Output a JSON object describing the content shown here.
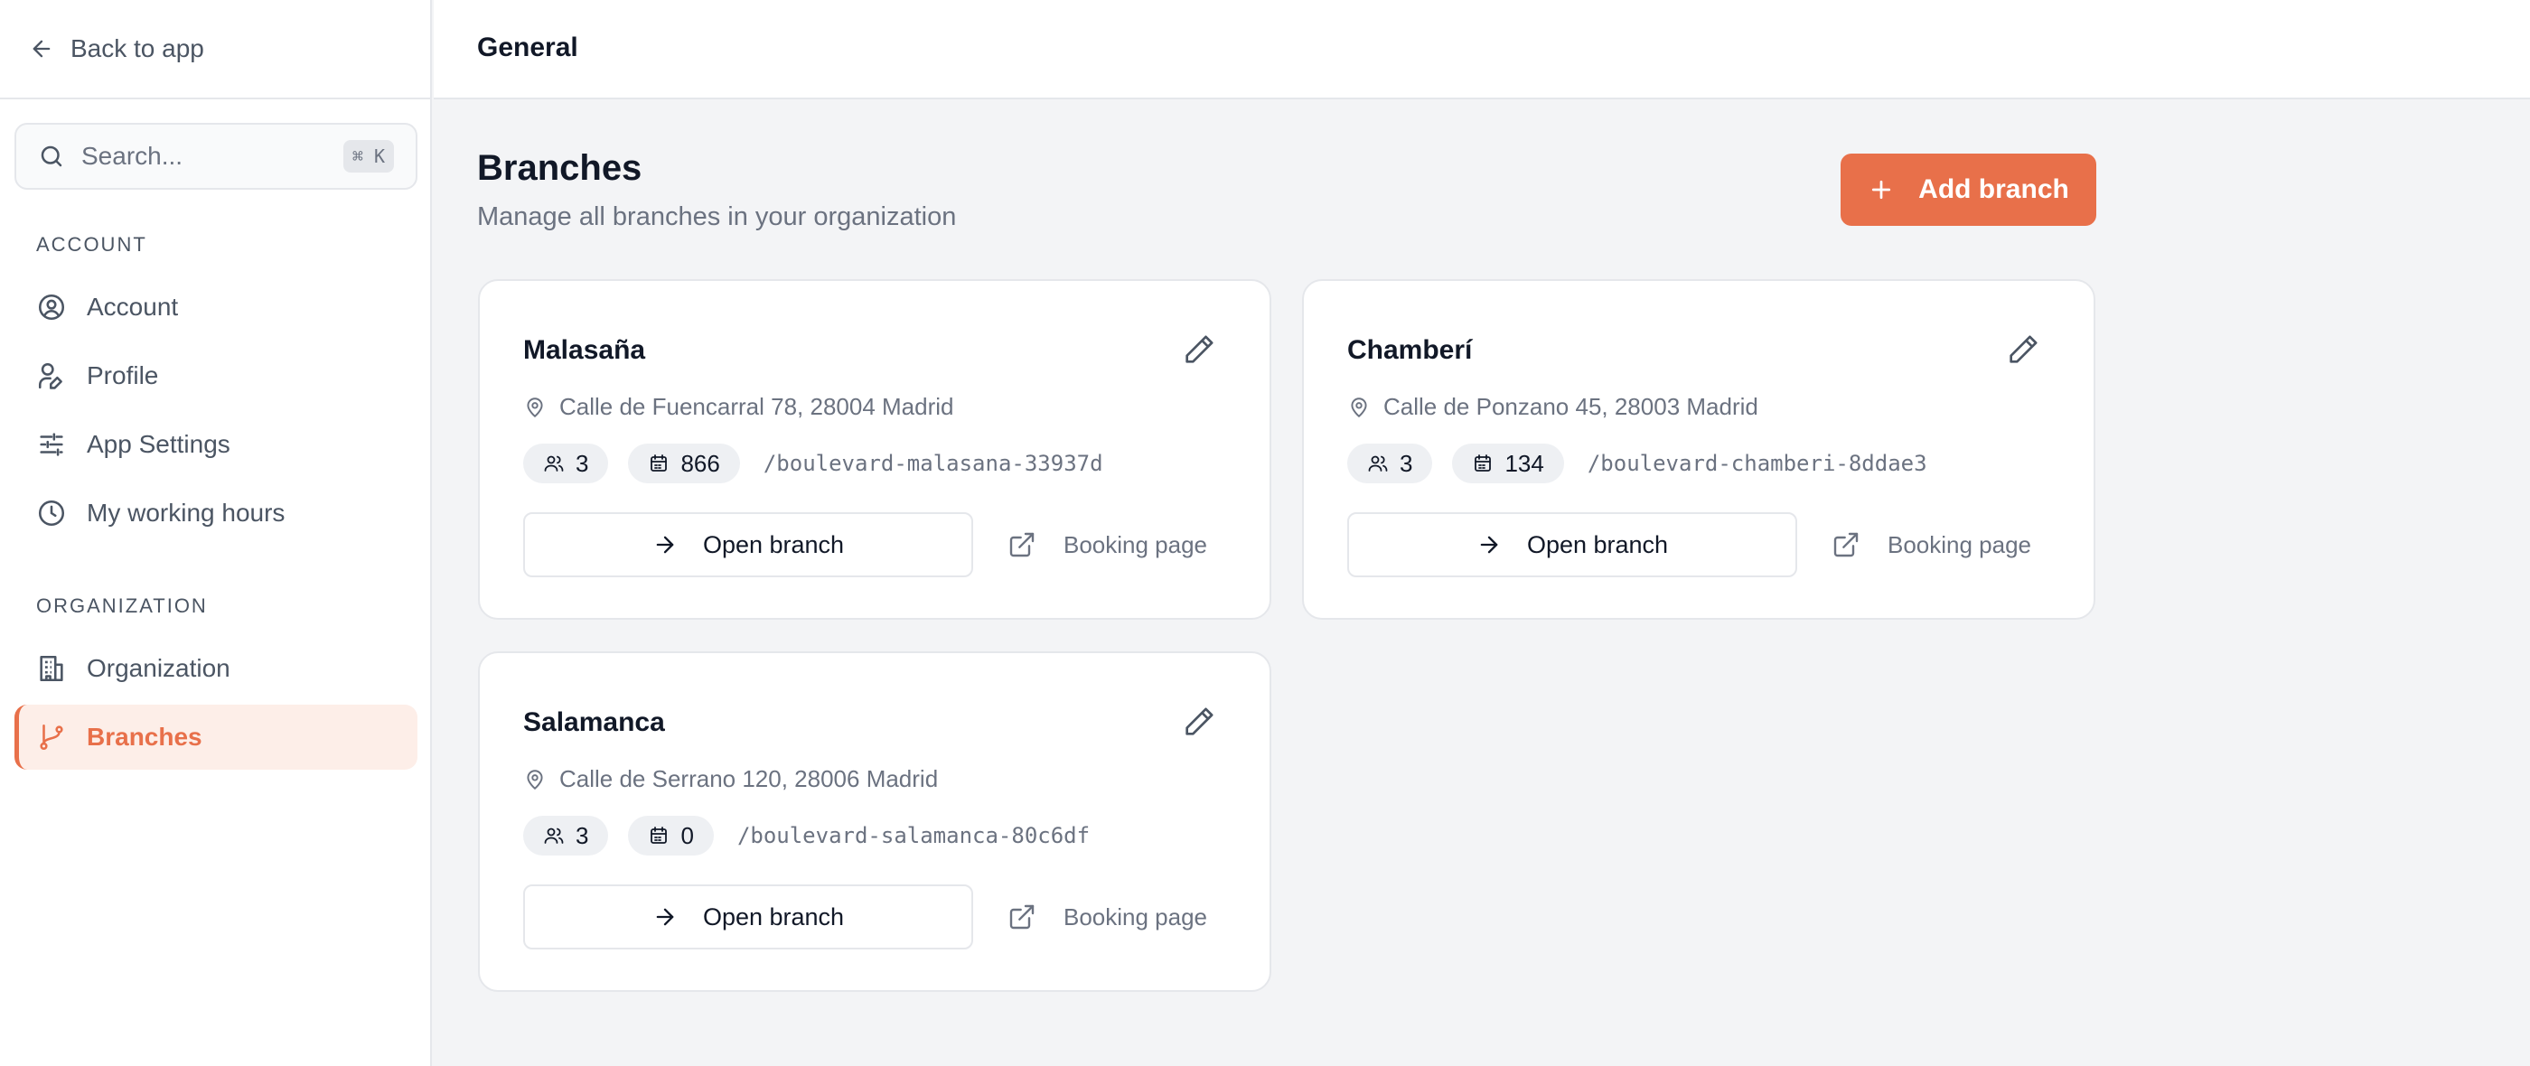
{
  "sidebar": {
    "back_label": "Back to app",
    "search": {
      "placeholder": "Search...",
      "shortcut": "⌘ K"
    },
    "account_section": "ACCOUNT",
    "account_items": [
      {
        "label": "Account",
        "icon": "user-circle-icon"
      },
      {
        "label": "Profile",
        "icon": "user-edit-icon"
      },
      {
        "label": "App Settings",
        "icon": "sliders-icon"
      },
      {
        "label": "My working hours",
        "icon": "clock-icon"
      }
    ],
    "organization_section": "ORGANIZATION",
    "organization_items": [
      {
        "label": "Organization",
        "icon": "building-icon"
      },
      {
        "label": "Branches",
        "icon": "git-branch-icon",
        "active": true
      }
    ]
  },
  "header": {
    "title": "General"
  },
  "page": {
    "title": "Branches",
    "subtitle": "Manage all branches in your organization",
    "add_button": "Add branch"
  },
  "branches": [
    {
      "name": "Malasaña",
      "address": "Calle de Fuencarral 78, 28004 Madrid",
      "members": "3",
      "bookings": "866",
      "slug": "/boulevard-malasana-33937d",
      "open_label": "Open branch",
      "booking_label": "Booking page"
    },
    {
      "name": "Chamberí",
      "address": "Calle de Ponzano 45, 28003 Madrid",
      "members": "3",
      "bookings": "134",
      "slug": "/boulevard-chamberi-8ddae3",
      "open_label": "Open branch",
      "booking_label": "Booking page"
    },
    {
      "name": "Salamanca",
      "address": "Calle de Serrano 120, 28006 Madrid",
      "members": "3",
      "bookings": "0",
      "slug": "/boulevard-salamanca-80c6df",
      "open_label": "Open branch",
      "booking_label": "Booking page"
    }
  ],
  "colors": {
    "accent": "#e8704a",
    "accent_bg": "#fdeee8",
    "muted": "#6b7280",
    "border": "#e5e7eb"
  }
}
